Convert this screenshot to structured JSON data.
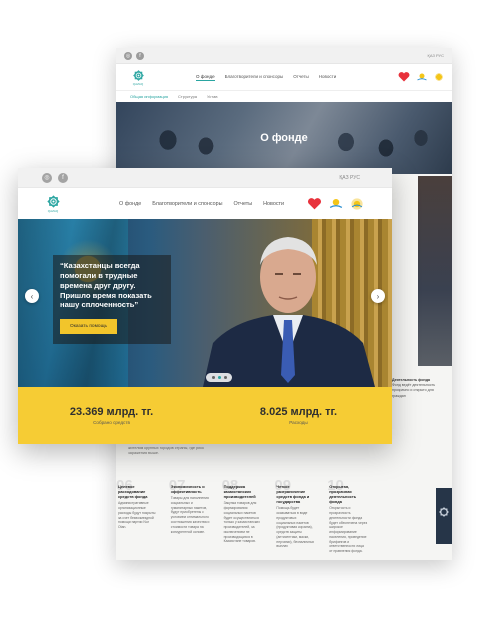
{
  "colors": {
    "accent": "#2aa5a1",
    "yellow": "#f6cc34",
    "dark": "#263548"
  },
  "back": {
    "lang": "ҚАЗ РУС",
    "logo_text": "QAZAQ",
    "menu": [
      "О фонде",
      "Благотворители и спонсоры",
      "Отчеты",
      "Новости"
    ],
    "subnav": [
      "Общая информация",
      "Структура",
      "Устав"
    ],
    "hero_title": "О фонде",
    "side_title": "Деятельность фонда",
    "side_text": "Фонд ведёт деятельность прозрачно и открыто для граждан",
    "faded_text": "пострадавших граждан, категории установлены. Помощь будет оказываться жителям крупных городов страны, где риск заражения выше.",
    "columns": [
      {
        "num": "06",
        "title": "Целевое расходование средств фонда",
        "text": "Административные организационные расходы будут покрыты за счет безвозмездной помощи партии Nur Otan."
      },
      {
        "num": "07",
        "title": "Экономичность и эффективность",
        "text": "Товары для наполнения социальных и гуманитарных пакетов, будут приобретены с условием оптимального соотношения качества и стоимости товара на конкурентной основе."
      },
      {
        "num": "08",
        "title": "Поддержка казахстанских производителей",
        "text": "Закупка товаров для формирования социальных пакетов будет осуществляться только у казахстанских производителей, за исключением не производящихся в Казахстане товаров."
      },
      {
        "num": "09",
        "title": "Четкое разграничение средств фонда и государства",
        "text": "Помощь будет оказываться в виде продуктовых социальных пакетов (продуктовая корзина), средств защиты (антисептики, маски, перчатки), безналичных выплат."
      },
      {
        "num": "10",
        "title": "Открытая, прозрачная деятельность фонда",
        "text": "Открытость и прозрачность деятельности фонда будет обеспечена через широкое информирование населения, проведение брифингов и ответственности лица от правления фонда."
      }
    ]
  },
  "front": {
    "lang": "ҚАЗ РУС",
    "logo_text": "QAZAQ",
    "menu": [
      "О фонде",
      "Благотворители и спонсоры",
      "Отчеты",
      "Новости"
    ],
    "quote": "“Казахстанцы всегда помогали в трудные времена друг другу. Пришло время показать нашу сплоченность”",
    "cta": "Оказать помощь",
    "slider_active": 2,
    "slider_total": 3,
    "stats": [
      {
        "value": "23.369 млрд. тг.",
        "label": "Собрано средств"
      },
      {
        "value": "8.025 млрд. тг.",
        "label": "Расходы"
      }
    ]
  },
  "icons": [
    "instagram-icon",
    "facebook-icon",
    "heart-icon",
    "sun-emblem-icon",
    "logo-emblem-icon",
    "arrow-left-icon",
    "arrow-right-icon"
  ]
}
